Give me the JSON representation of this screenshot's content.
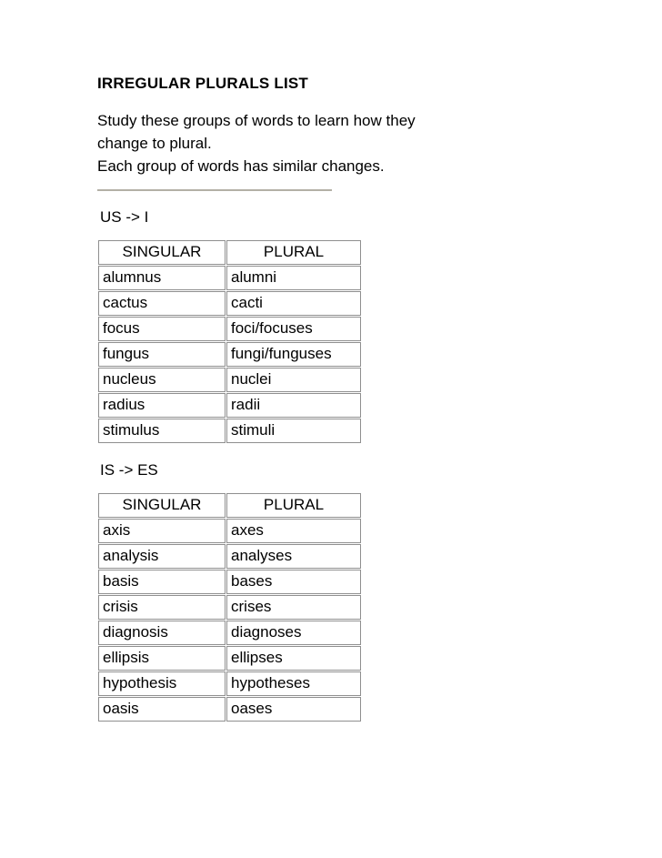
{
  "document": {
    "title": "IRREGULAR PLURALS LIST",
    "intro_line_1": "Study these groups of words to learn how they",
    "intro_line_2": "change to plural.",
    "intro_line_3": "Each group of words has similar changes."
  },
  "colors": {
    "text": "#000000",
    "page_background": "#ffffff",
    "cell_border": "#8f8f8f",
    "divider": "#b3b0a6"
  },
  "sections": [
    {
      "label": "US -> I",
      "table": {
        "headers": [
          "SINGULAR",
          "PLURAL"
        ],
        "rows": [
          [
            "alumnus",
            "alumni"
          ],
          [
            "cactus",
            "cacti"
          ],
          [
            "focus",
            "foci/focuses"
          ],
          [
            "fungus",
            "fungi/funguses"
          ],
          [
            "nucleus",
            "nuclei"
          ],
          [
            "radius",
            "radii"
          ],
          [
            "stimulus",
            "stimuli"
          ]
        ]
      }
    },
    {
      "label": "IS -> ES",
      "table": {
        "headers": [
          "SINGULAR",
          "PLURAL"
        ],
        "rows": [
          [
            "axis",
            "axes"
          ],
          [
            "analysis",
            "analyses"
          ],
          [
            "basis",
            "bases"
          ],
          [
            "crisis",
            "crises"
          ],
          [
            "diagnosis",
            "diagnoses"
          ],
          [
            "ellipsis",
            "ellipses"
          ],
          [
            "hypothesis",
            "hypotheses"
          ],
          [
            "oasis",
            "oases"
          ]
        ]
      }
    }
  ]
}
